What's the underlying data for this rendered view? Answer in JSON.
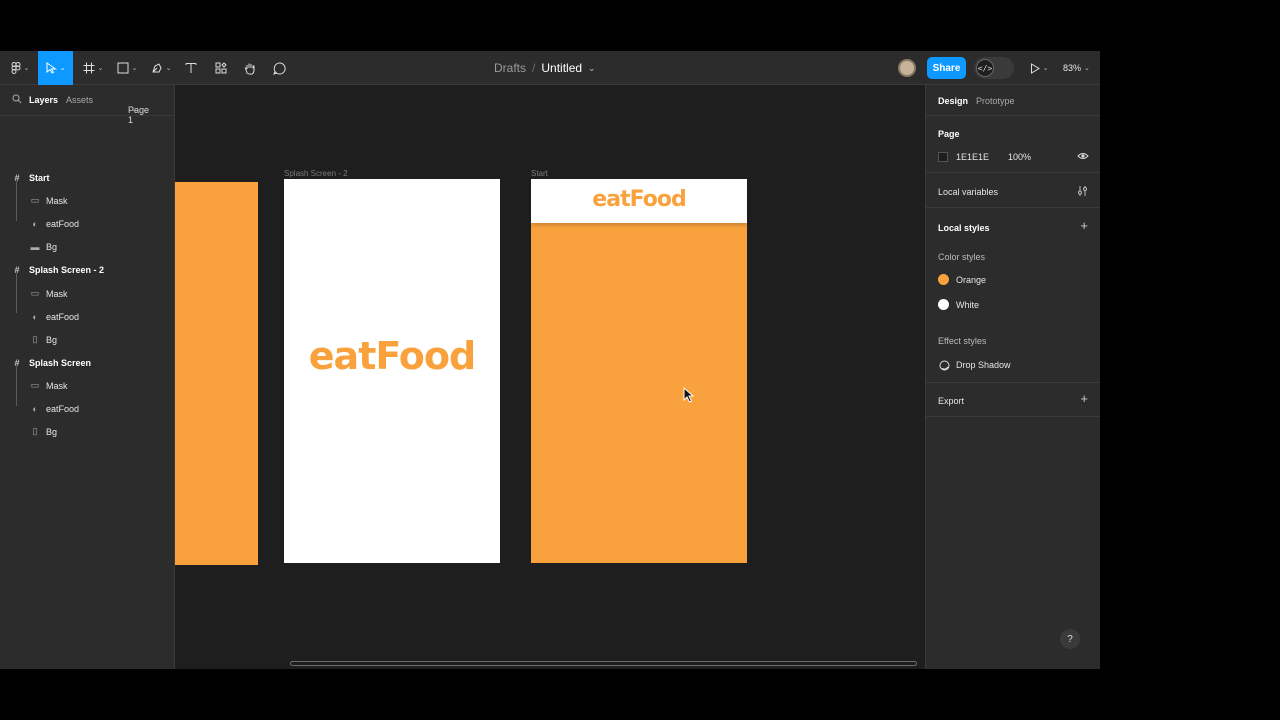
{
  "toolbar": {
    "breadcrumb_parent": "Drafts",
    "breadcrumb_sep": "/",
    "file_name": "Untitled",
    "share_label": "Share",
    "devmode_glyph": "</>",
    "zoom_level": "83%",
    "tools": [
      "main-menu-icon",
      "move-tool-icon",
      "frame-tool-icon",
      "shape-tool-icon",
      "pen-tool-icon",
      "text-tool-icon",
      "resources-icon",
      "hand-tool-icon",
      "comment-tool-icon"
    ]
  },
  "left_panel": {
    "tab_layers": "Layers",
    "tab_assets": "Assets",
    "page_selector": "Page 1",
    "layers": [
      {
        "name": "Start",
        "type": "frame"
      },
      {
        "name": "Mask",
        "type": "rect"
      },
      {
        "name": "eatFood",
        "type": "component"
      },
      {
        "name": "Bg",
        "type": "rect"
      },
      {
        "name": "Splash Screen - 2",
        "type": "frame"
      },
      {
        "name": "Mask",
        "type": "rect"
      },
      {
        "name": "eatFood",
        "type": "component"
      },
      {
        "name": "Bg",
        "type": "rect"
      },
      {
        "name": "Splash Screen",
        "type": "frame"
      },
      {
        "name": "Mask",
        "type": "rect"
      },
      {
        "name": "eatFood",
        "type": "component"
      },
      {
        "name": "Bg",
        "type": "rect"
      }
    ]
  },
  "canvas": {
    "frame_label_splash2": "Splash Screen - 2",
    "frame_label_start": "Start",
    "logo_text": "eatFood",
    "colors": {
      "orange": "#F9A23D",
      "white": "#FFFFFF",
      "canvas_bg": "#1E1E1E"
    }
  },
  "right_panel": {
    "tab_design": "Design",
    "tab_prototype": "Prototype",
    "page_heading": "Page",
    "page_color": "1E1E1E",
    "page_opacity": "100%",
    "local_variables": "Local variables",
    "local_styles": "Local styles",
    "color_styles_heading": "Color styles",
    "color_styles": [
      {
        "name": "Orange",
        "color": "#F9A23D"
      },
      {
        "name": "White",
        "color": "#FFFFFF"
      }
    ],
    "effect_styles_heading": "Effect styles",
    "effect_style_name": "Drop Shadow",
    "export": "Export",
    "help": "?"
  }
}
